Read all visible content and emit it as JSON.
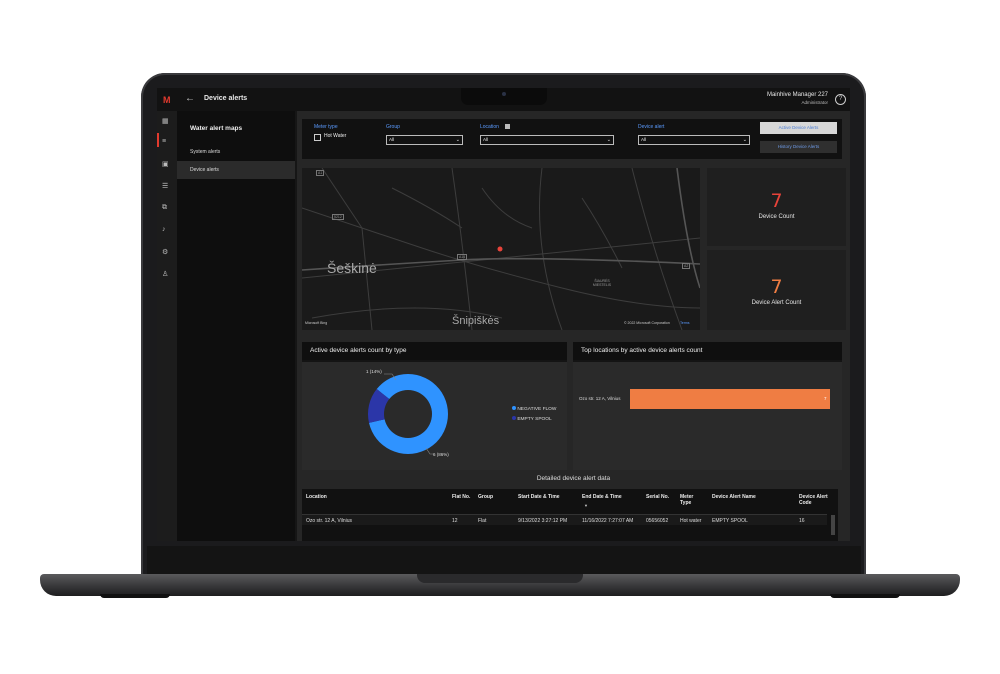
{
  "app": {
    "title": "Device alerts",
    "back_icon": "←",
    "logo_icon": "M",
    "user_name": "Mainhive Manager 227",
    "user_role": "Administrator",
    "help_icon": "?"
  },
  "rail": {
    "icons": [
      "dashboard-icon",
      "report-icon",
      "image-icon",
      "list-icon",
      "devices-icon",
      "bell-icon",
      "settings-icon",
      "user-icon"
    ],
    "glyphs": [
      "▦",
      "≡",
      "▣",
      "☰",
      "⧉",
      "♪",
      "⚙",
      "♙"
    ]
  },
  "sidepanel": {
    "title": "Water alert maps",
    "items": [
      "System alerts",
      "Device alerts"
    ]
  },
  "filters": {
    "meter_type_label": "Meter type",
    "hot_water_label": "Hot Water",
    "group_label": "Group",
    "group_value": "All",
    "location_label": "Location",
    "location_value": "All",
    "device_alert_label": "Device alert",
    "device_alert_value": "All",
    "active_button": "Active Device Alerts",
    "history_button": "History Device Alerts"
  },
  "map": {
    "place1": "Šeškinė",
    "place2": "Šnipiškės",
    "place3": "ŠIAURĖS MIESTELIS",
    "road_a1": "A1",
    "road_a2": "A14",
    "road_a3": "A2",
    "road_b": "5212",
    "attribution": "Microsoft Bing",
    "copyright": "© 2022 Microsoft Corporation",
    "terms": "Terms"
  },
  "kpis": {
    "device_count": "7",
    "device_count_label": "Device Count",
    "alert_count": "7",
    "alert_count_label": "Device Alert Count"
  },
  "colors": {
    "accent_red": "#e23a2e",
    "kpi_red": "#e8433a",
    "kpi_orange": "#ef7d43",
    "negative_flow": "#2f93ff",
    "empty_spool": "#2b36a8",
    "bar": "#ef7d43",
    "link": "#5b9bff"
  },
  "donut_card": {
    "title": "Active device alerts count by type",
    "label_small": "1 (14%)",
    "label_large": "6 (86%)",
    "legend": [
      "NEGATIVE FLOW",
      "EMPTY SPOOL"
    ]
  },
  "bar_card": {
    "title": "Top locations by active device alerts count",
    "category": "Ozo str. 12 A, Vilnius",
    "value_label": "7"
  },
  "chart_data": [
    {
      "type": "pie",
      "categories": [
        "NEGATIVE FLOW",
        "EMPTY SPOOL"
      ],
      "values": [
        6,
        1
      ],
      "title": "Active device alerts count by type"
    },
    {
      "type": "bar",
      "categories": [
        "Ozo str. 12 A, Vilnius"
      ],
      "values": [
        7
      ],
      "title": "Top locations by active device alerts count"
    }
  ],
  "table": {
    "title": "Detailed device alert data",
    "headers": [
      "Location",
      "Flat No.",
      "Group",
      "Start Date & Time",
      "End Date & Time",
      "Serial No.",
      "Meter Type",
      "Device Alert Name",
      "Device Alert Code"
    ],
    "rows": [
      [
        "Ozo str. 12 A, Vilnius",
        "12",
        "Flat",
        "9/13/2022 3:27:12 PM",
        "11/16/2022 7:27:07 AM",
        "05656052",
        "Hot water",
        "EMPTY SPOOL",
        "16"
      ]
    ]
  }
}
